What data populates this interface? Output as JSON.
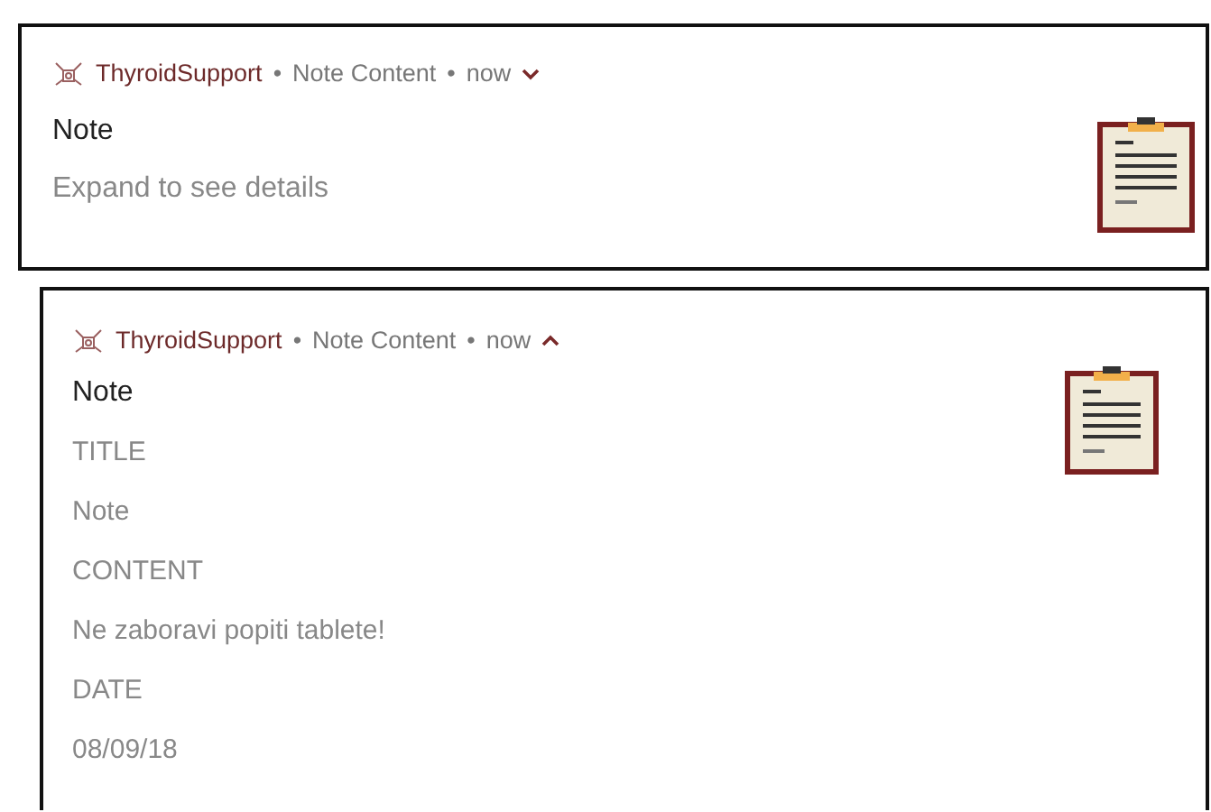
{
  "notifications": [
    {
      "app": "ThyroidSupport",
      "separator_1": "•",
      "subtext": "Note Content",
      "separator_2": "•",
      "time": "now",
      "expanded": false,
      "title": "Note",
      "lines": [
        "Expand to see details"
      ]
    },
    {
      "app": "ThyroidSupport",
      "separator_1": "•",
      "subtext": "Note Content",
      "separator_2": "•",
      "time": "now",
      "expanded": true,
      "title": "Note",
      "lines": [
        "TITLE",
        "Note",
        "CONTENT",
        "Ne zaboravi popiti tablete!",
        "DATE",
        "08/09/18"
      ]
    }
  ]
}
